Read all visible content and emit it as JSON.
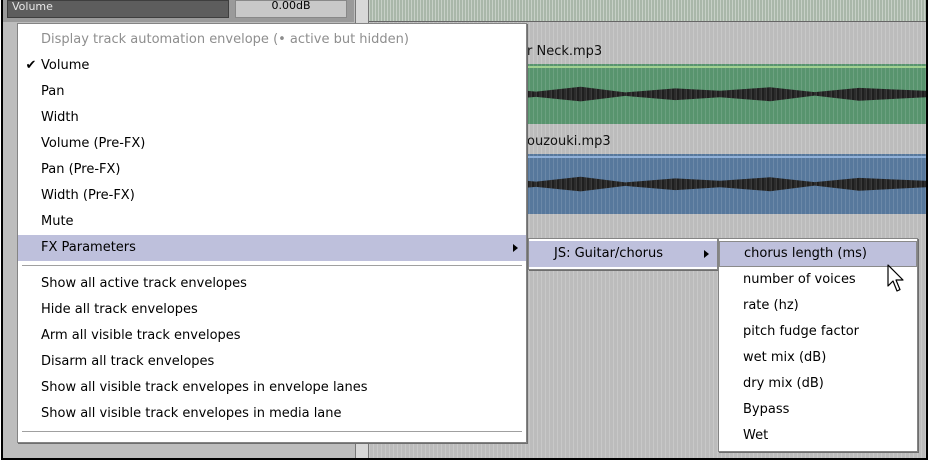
{
  "toolbar": {
    "volume_label": "Volume",
    "volume_value": "0.00dB"
  },
  "tracks": [
    {
      "name": "r Neck.mp3",
      "color": "#58946e"
    },
    {
      "name": "ouzouki.mp3",
      "color": "#57789c"
    }
  ],
  "menu": {
    "header": "Display track automation envelope (• active but hidden)",
    "check_glyph": "✔",
    "items": [
      {
        "label": "Volume",
        "checked": true
      },
      {
        "label": "Pan"
      },
      {
        "label": "Width"
      },
      {
        "label": "Volume (Pre-FX)"
      },
      {
        "label": "Pan (Pre-FX)"
      },
      {
        "label": "Width (Pre-FX)"
      },
      {
        "label": "Mute"
      },
      {
        "label": "FX Parameters",
        "submenu": true,
        "highlighted": true
      }
    ],
    "actions": [
      "Show all active track envelopes",
      "Hide all track envelopes",
      "Arm all visible track envelopes",
      "Disarm all track envelopes",
      "Show all visible track envelopes in envelope lanes",
      "Show all visible track envelopes in media lane"
    ]
  },
  "fx_submenu": {
    "items": [
      {
        "label": "JS: Guitar/chorus",
        "submenu": true,
        "highlighted": true
      }
    ]
  },
  "param_submenu": {
    "items": [
      {
        "label": "chorus length (ms)",
        "highlighted": true
      },
      {
        "label": "number of voices"
      },
      {
        "label": "rate (hz)"
      },
      {
        "label": "pitch fudge factor"
      },
      {
        "label": "wet mix (dB)"
      },
      {
        "label": "dry mix (dB)"
      },
      {
        "label": "Bypass"
      },
      {
        "label": "Wet"
      }
    ]
  },
  "colors": {
    "highlight": "#bec0dc",
    "menu_bg": "#ffffff",
    "disabled_text": "#8e8e8e"
  }
}
